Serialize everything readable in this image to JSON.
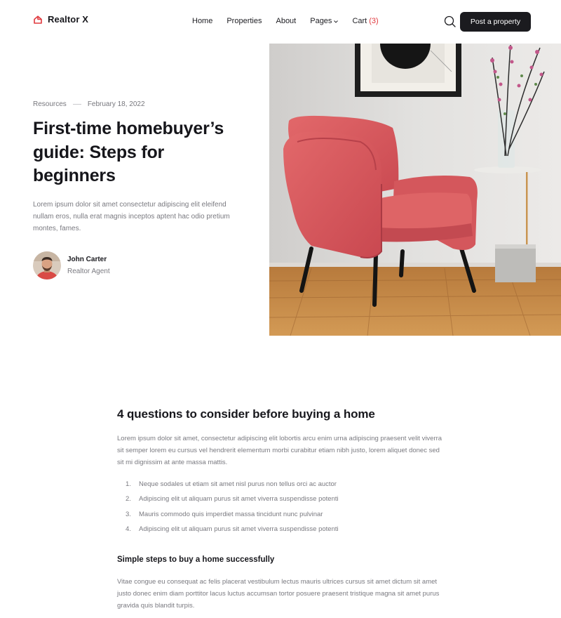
{
  "brand": {
    "name": "Realtor X",
    "accent": "#e0393e"
  },
  "nav": {
    "items": [
      {
        "label": "Home"
      },
      {
        "label": "Properties"
      },
      {
        "label": "About"
      },
      {
        "label": "Pages"
      }
    ],
    "cart_label": "Cart",
    "cart_count": "(3)",
    "post_button": "Post a property"
  },
  "hero": {
    "category": "Resources",
    "date": "February 18, 2022",
    "title": "First-time homebuyer’s guide: Steps for beginners",
    "description": "Lorem ipsum dolor sit amet consectetur adipiscing elit eleifend nullam eros, nulla erat magnis inceptos aptent hac odio pretium montes, fames.",
    "author": {
      "name": "John Carter",
      "role": "Realtor Agent"
    }
  },
  "article": {
    "heading": "4 questions to consider before buying a home",
    "intro": "Lorem ipsum dolor sit amet, consectetur adipiscing elit lobortis arcu enim urna adipiscing praesent velit viverra sit semper lorem eu cursus vel hendrerit elementum morbi curabitur etiam nibh justo, lorem aliquet donec sed sit mi dignissim at ante massa mattis.",
    "list": [
      {
        "num": "1.",
        "text": "Neque sodales ut etiam sit amet nisl purus non tellus orci ac auctor"
      },
      {
        "num": "2.",
        "text": "Adipiscing elit ut aliquam purus sit amet viverra suspendisse potenti"
      },
      {
        "num": "3.",
        "text": "Mauris commodo quis imperdiet massa tincidunt nunc pulvinar"
      },
      {
        "num": "4.",
        "text": "Adipiscing elit ut aliquam purus sit amet viverra suspendisse potenti"
      }
    ],
    "subheading": "Simple steps to buy a home successfully",
    "body": "Vitae congue eu consequat ac felis placerat vestibulum lectus mauris ultrices cursus sit amet dictum sit amet justo donec enim diam porttitor lacus luctus accumsan tortor posuere praesent tristique magna sit amet purus gravida quis blandit turpis."
  }
}
